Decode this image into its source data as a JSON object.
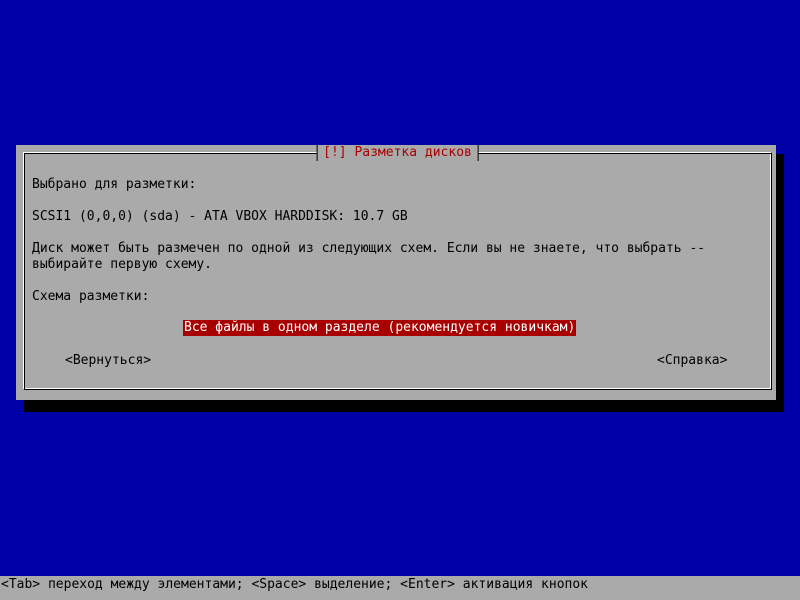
{
  "dialog": {
    "title": "[!] Разметка дисков",
    "selected_label": "Выбрано для разметки:",
    "disk": "SCSI1 (0,0,0) (sda) - ATA VBOX HARDDISK: 10.7 GB",
    "description_line1": "Диск может быть размечен по одной из следующих схем. Если вы не знаете, что выбрать --",
    "description_line2": "выбирайте первую схему.",
    "scheme_label": "Схема разметки:",
    "options": [
      "Все файлы в одном разделе (рекомендуется новичкам)"
    ],
    "back_button": "<Вернуться>",
    "help_button": "<Справка>"
  },
  "statusbar": {
    "hint": "<Tab> переход между элементами; <Space> выделение; <Enter> активация кнопок"
  },
  "colors": {
    "background": "#0000a8",
    "dialog": "#aaaaaa",
    "accent": "#a80000",
    "highlight_text": "#ffffff"
  }
}
